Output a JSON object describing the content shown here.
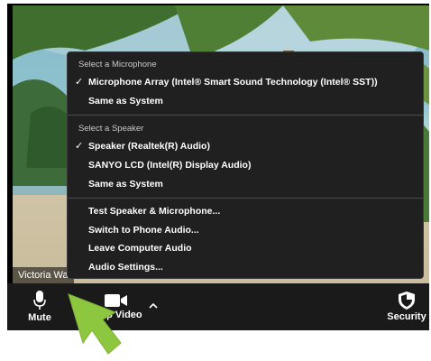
{
  "video": {
    "participant_name": "Victoria Wa"
  },
  "menu": {
    "mic_section_title": "Select a Microphone",
    "mic_items": [
      {
        "label": "Microphone Array (Intel® Smart Sound Technology (Intel® SST))",
        "checked": true
      },
      {
        "label": "Same as System",
        "checked": false
      }
    ],
    "speaker_section_title": "Select a Speaker",
    "speaker_items": [
      {
        "label": "Speaker (Realtek(R) Audio)",
        "checked": true
      },
      {
        "label": "SANYO LCD (Intel(R) Display Audio)",
        "checked": false
      },
      {
        "label": "Same as System",
        "checked": false
      }
    ],
    "action_items": [
      {
        "label": "Test Speaker & Microphone..."
      },
      {
        "label": "Switch to Phone Audio..."
      },
      {
        "label": "Leave Computer Audio"
      },
      {
        "label": "Audio Settings..."
      }
    ],
    "check_glyph": "✓"
  },
  "toolbar": {
    "mute_label": "Mute",
    "video_label": "Stop Video",
    "security_label": "Security",
    "chevron_glyph": "^"
  },
  "colors": {
    "toolbar_bg": "#1a1a1a",
    "menu_bg": "#202020",
    "arrow": "#8dc63f"
  }
}
